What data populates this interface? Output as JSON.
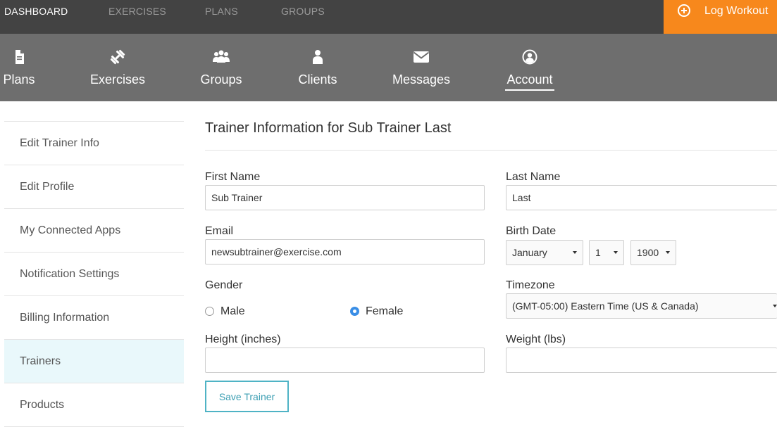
{
  "top_nav": {
    "tabs": [
      {
        "label": "DASHBOARD",
        "active": true
      },
      {
        "label": "EXERCISES",
        "active": false
      },
      {
        "label": "PLANS",
        "active": false
      },
      {
        "label": "GROUPS",
        "active": false
      }
    ],
    "log_workout_label": "Log Workout",
    "log_workout_icon": "plus-circle-icon"
  },
  "icon_nav": {
    "items": [
      {
        "label": "Plans",
        "icon": "document-icon"
      },
      {
        "label": "Exercises",
        "icon": "dumbbell-icon"
      },
      {
        "label": "Groups",
        "icon": "group-icon"
      },
      {
        "label": "Clients",
        "icon": "person-icon"
      },
      {
        "label": "Messages",
        "icon": "envelope-icon"
      },
      {
        "label": "Account",
        "icon": "user-circle-icon",
        "active": true
      }
    ]
  },
  "sidebar": {
    "items": [
      {
        "label": "Edit Trainer Info"
      },
      {
        "label": "Edit Profile"
      },
      {
        "label": "My Connected Apps"
      },
      {
        "label": "Notification Settings"
      },
      {
        "label": "Billing Information"
      },
      {
        "label": "Trainers",
        "active": true
      },
      {
        "label": "Products"
      }
    ]
  },
  "form": {
    "title": "Trainer Information for Sub Trainer Last",
    "first_name": {
      "label": "First Name",
      "value": "Sub Trainer"
    },
    "last_name": {
      "label": "Last Name",
      "value": "Last"
    },
    "email": {
      "label": "Email",
      "value": "newsubtrainer@exercise.com"
    },
    "birth_date": {
      "label": "Birth Date",
      "month": "January",
      "day": "1",
      "year": "1900"
    },
    "gender": {
      "label": "Gender",
      "options": [
        "Male",
        "Female"
      ],
      "selected": "Female"
    },
    "timezone": {
      "label": "Timezone",
      "value": "(GMT-05:00) Eastern Time (US & Canada)"
    },
    "height": {
      "label": "Height (inches)",
      "value": ""
    },
    "weight": {
      "label": "Weight (lbs)",
      "value": ""
    },
    "save_label": "Save Trainer"
  },
  "colors": {
    "top_bar": "#434343",
    "icon_nav": "#6e6e6e",
    "accent_orange": "#f7881c",
    "active_sidebar_bg": "#e9f8fb",
    "save_button": "#4fb3c5",
    "radio_checked": "#3a8ee6"
  }
}
